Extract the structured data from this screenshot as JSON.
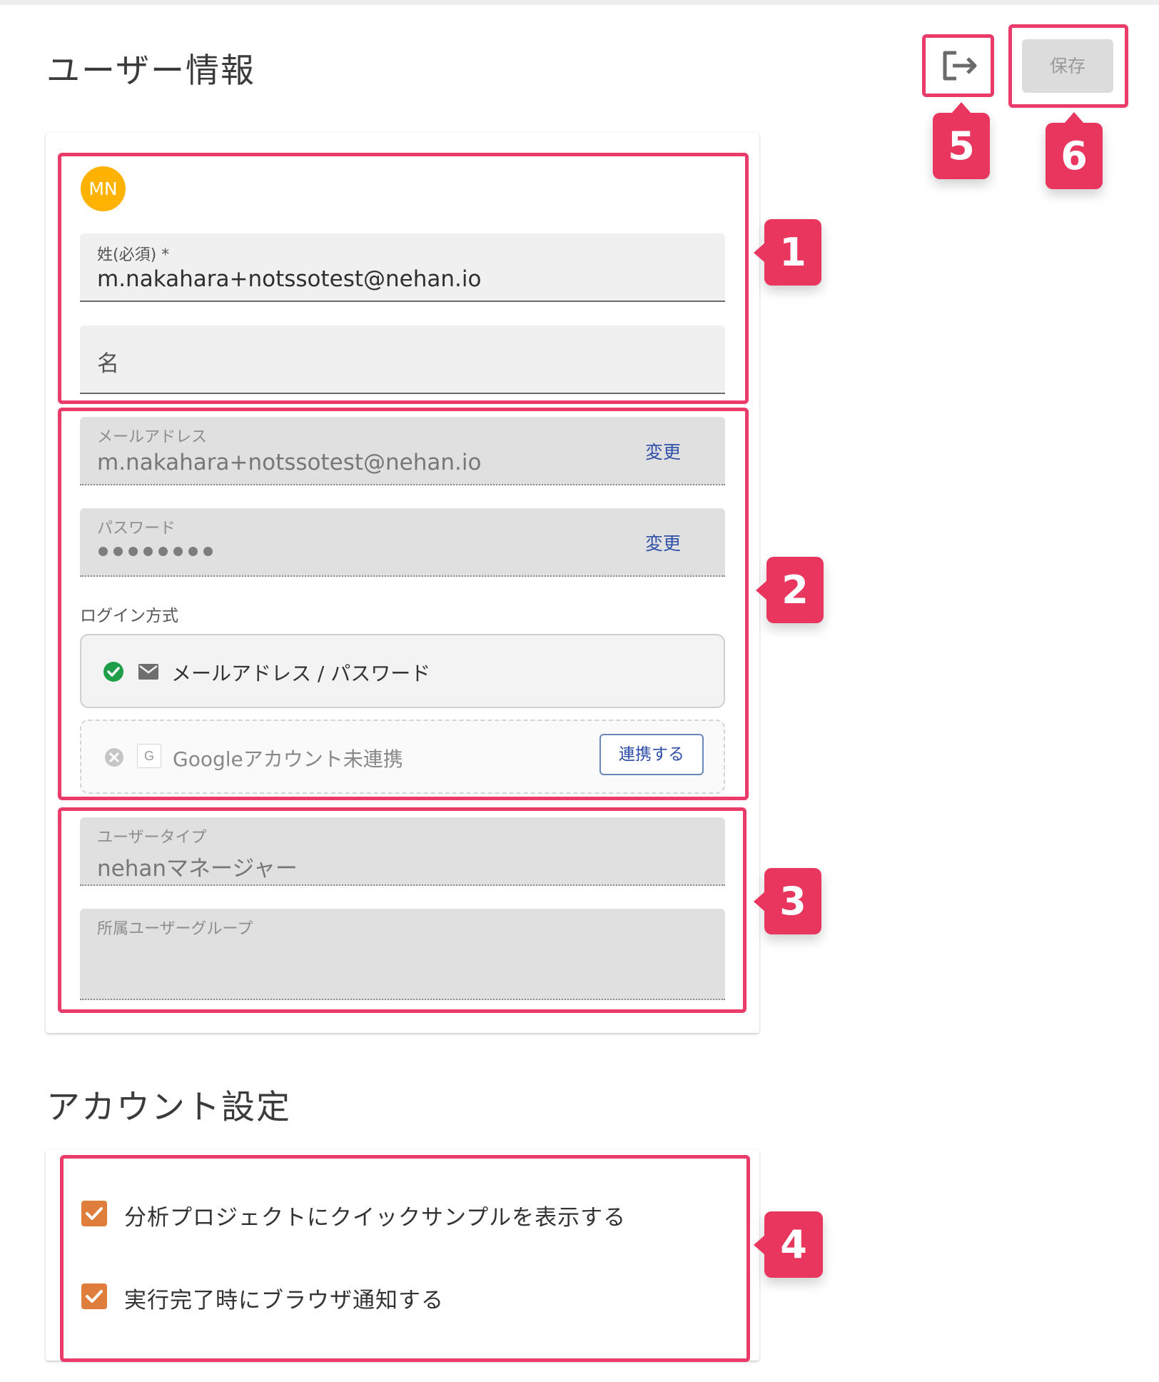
{
  "header": {
    "title": "ユーザー情報",
    "save_label": "保存"
  },
  "profile": {
    "avatar_initials": "MN",
    "last_name": {
      "label": "姓(必須) *",
      "value": "m.nakahara+notssotest@nehan.io"
    },
    "first_name": {
      "placeholder": "名"
    }
  },
  "credentials": {
    "email": {
      "label": "メールアドレス",
      "value": "m.nakahara+notssotest@nehan.io",
      "change_label": "変更"
    },
    "password": {
      "label": "パスワード",
      "change_label": "変更"
    },
    "login_method_label": "ログイン方式",
    "methods": [
      {
        "label": "メールアドレス / パスワード",
        "status": "connected"
      },
      {
        "label": "Googleアカウント未連携",
        "status": "not-connected",
        "action_label": "連携する"
      }
    ]
  },
  "user_info": {
    "user_type": {
      "label": "ユーザータイプ",
      "value": "nehanマネージャー"
    },
    "groups": {
      "label": "所属ユーザーグループ"
    }
  },
  "account_settings": {
    "title": "アカウント設定",
    "options": [
      {
        "label": "分析プロジェクトにクイックサンプルを表示する",
        "checked": true
      },
      {
        "label": "実行完了時にブラウザ通知する",
        "checked": true
      }
    ]
  },
  "annotations": [
    "1",
    "2",
    "3",
    "4",
    "5",
    "6"
  ],
  "colors": {
    "highlight": "#ea3c6a",
    "badge": "#e8365f",
    "avatar": "#ffb300",
    "checkbox": "#df7e3c",
    "link": "#2f4fa8",
    "check_green": "#1e9e49"
  }
}
